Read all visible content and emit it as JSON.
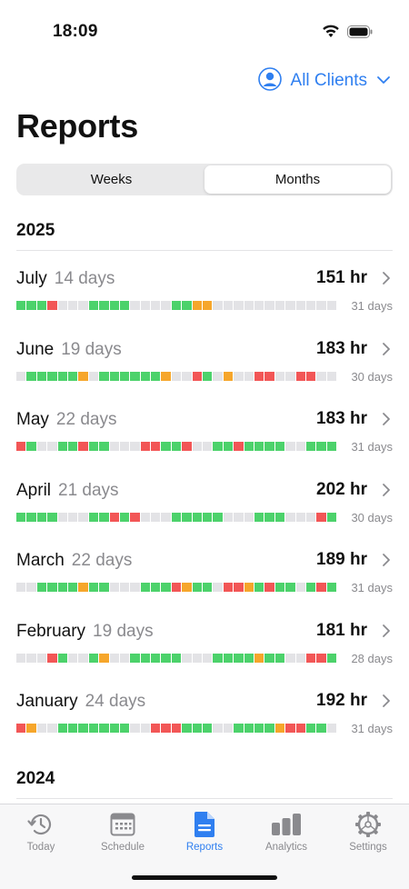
{
  "status": {
    "time": "18:09"
  },
  "client_picker": {
    "label": "All Clients"
  },
  "title": "Reports",
  "segments": [
    {
      "label": "Weeks",
      "active": false
    },
    {
      "label": "Months",
      "active": true
    }
  ],
  "colors": {
    "g": "#4cd26b",
    "r": "#f25656",
    "o": "#f6a62b",
    "e": "#e3e3e6",
    "accent": "#2f7ff0"
  },
  "years": [
    {
      "label": "2025",
      "months": [
        {
          "name": "July",
          "days_label": "14 days",
          "hours": "151 hr",
          "total_days": "31 days",
          "strip": "gggreeeggggeeeeggooeeeeeeeeeeee"
        },
        {
          "name": "June",
          "days_label": "19 days",
          "hours": "183 hr",
          "total_days": "30 days",
          "strip": "egggggoeggggggoeergeoeerreerreeg"
        },
        {
          "name": "May",
          "days_label": "22 days",
          "hours": "183 hr",
          "total_days": "31 days",
          "strip": "rgeeggrggeeerrggreeggrggggeeggggrg"
        },
        {
          "name": "April",
          "days_label": "21 days",
          "hours": "202 hr",
          "total_days": "30 days",
          "strip": "ggggeeeggrgreeegggggeeegggeeerggg"
        },
        {
          "name": "March",
          "days_label": "22 days",
          "hours": "189 hr",
          "total_days": "31 days",
          "strip": "eeggggoggeeegggroggerrogrggegrggggeeeg"
        },
        {
          "name": "February",
          "days_label": "19 days",
          "hours": "181 hr",
          "total_days": "28 days",
          "strip": "eeergeegoeegggggeeeggggoggeerrgg"
        },
        {
          "name": "January",
          "days_label": "24 days",
          "hours": "192 hr",
          "total_days": "31 days",
          "strip": "roeegggggggeerrrgggeeggggorrggeeggggoge"
        }
      ]
    },
    {
      "label": "2024",
      "months": []
    }
  ],
  "tabs": [
    {
      "label": "Today",
      "icon": "clock-history-icon",
      "active": false
    },
    {
      "label": "Schedule",
      "icon": "calendar-icon",
      "active": false
    },
    {
      "label": "Reports",
      "icon": "document-icon",
      "active": true
    },
    {
      "label": "Analytics",
      "icon": "bar-chart-icon",
      "active": false
    },
    {
      "label": "Settings",
      "icon": "gear-icon",
      "active": false
    }
  ]
}
